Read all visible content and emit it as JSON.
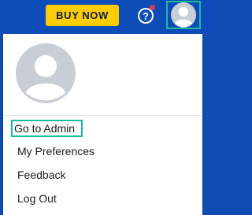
{
  "header": {
    "buy_now_label": "BUY NOW",
    "help_icon_glyph": "?",
    "help_icon": "question-circle-icon",
    "avatar_icon": "user-avatar-icon",
    "notification_dot_color": "#e23b4f",
    "accent_color": "#1abc9c"
  },
  "menu": {
    "avatar_icon": "user-avatar-icon",
    "items": [
      {
        "label": "Go to Admin",
        "focused": true
      },
      {
        "label": "My Preferences"
      },
      {
        "label": "Feedback"
      },
      {
        "label": "Log Out"
      }
    ]
  }
}
